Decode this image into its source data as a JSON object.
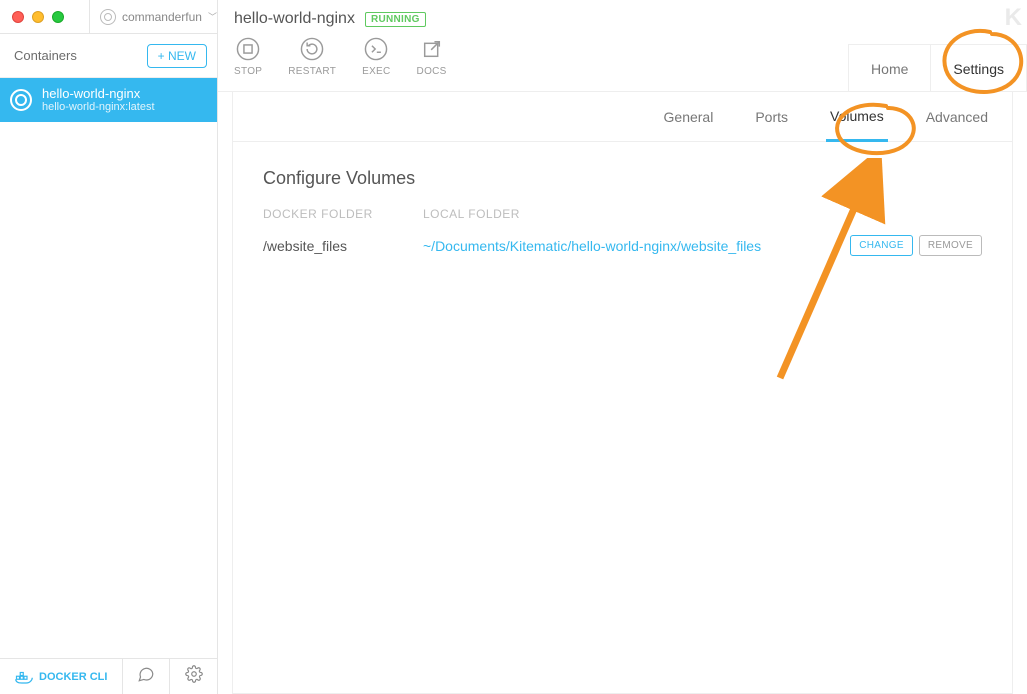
{
  "user": {
    "name": "commanderfun"
  },
  "sidebar": {
    "heading": "Containers",
    "new_button": "+ NEW",
    "items": [
      {
        "name": "hello-world-nginx",
        "sub": "hello-world-nginx:latest"
      }
    ],
    "footer": {
      "cli": "DOCKER CLI"
    }
  },
  "header": {
    "title": "hello-world-nginx",
    "status": "RUNNING",
    "toolbar": {
      "stop": "STOP",
      "restart": "RESTART",
      "exec": "EXEC",
      "docs": "DOCS"
    },
    "tabs": {
      "home": "Home",
      "settings": "Settings"
    }
  },
  "subtabs": {
    "general": "General",
    "ports": "Ports",
    "volumes": "Volumes",
    "advanced": "Advanced"
  },
  "volumes": {
    "title": "Configure Volumes",
    "col_docker": "DOCKER FOLDER",
    "col_local": "LOCAL FOLDER",
    "rows": [
      {
        "docker": "/website_files",
        "local": "~/Documents/Kitematic/hello-world-nginx/website_files"
      }
    ],
    "change_label": "CHANGE",
    "remove_label": "REMOVE"
  },
  "brand": "K"
}
